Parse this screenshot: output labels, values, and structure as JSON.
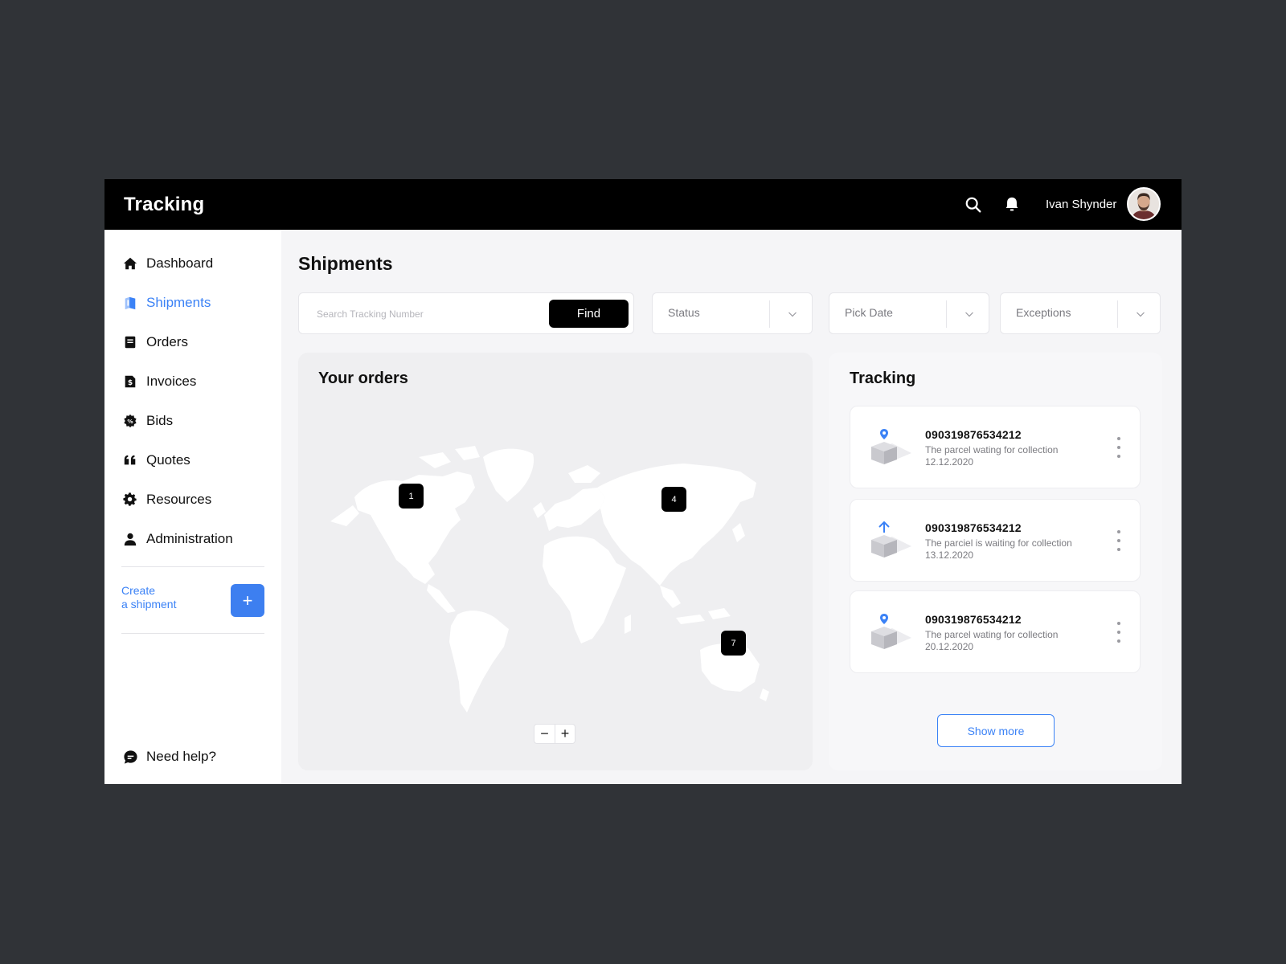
{
  "header": {
    "title": "Tracking",
    "user_name": "Ivan Shynder"
  },
  "sidebar": {
    "items": [
      {
        "label": "Dashboard",
        "icon": "home-icon"
      },
      {
        "label": "Shipments",
        "icon": "shipments-icon",
        "active": true
      },
      {
        "label": "Orders",
        "icon": "orders-icon"
      },
      {
        "label": "Invoices",
        "icon": "invoice-icon"
      },
      {
        "label": "Bids",
        "icon": "bids-icon"
      },
      {
        "label": "Quotes",
        "icon": "quote-icon"
      },
      {
        "label": "Resources",
        "icon": "gear-icon"
      },
      {
        "label": "Administration",
        "icon": "user-icon"
      }
    ],
    "create_line1": "Create",
    "create_line2": "a shipment",
    "create_button": "+",
    "help_label": "Need help?"
  },
  "main": {
    "page_title": "Shipments",
    "search_placeholder": "Search Tracking Number",
    "find_label": "Find",
    "filters": [
      "Status",
      "Pick Date",
      "Exceptions"
    ]
  },
  "orders": {
    "title": "Your orders",
    "pins": [
      "1",
      "4",
      "7"
    ],
    "zoom_out": "−",
    "zoom_in": "+"
  },
  "tracking": {
    "title": "Tracking",
    "items": [
      {
        "number": "090319876534212",
        "status": "The parcel wating for collection",
        "date": "12.12.2020",
        "icon": "location-pin-icon"
      },
      {
        "number": "090319876534212",
        "status": "The parciel is waiting for collection",
        "date": "13.12.2020",
        "icon": "arrow-up-icon"
      },
      {
        "number": "090319876534212",
        "status": "The parcel wating for collection",
        "date": "20.12.2020",
        "icon": "location-pin-icon"
      }
    ],
    "show_more": "Show more"
  },
  "colors": {
    "accent": "#3b82f6",
    "topbar": "#000000",
    "backdrop": "#303337"
  }
}
